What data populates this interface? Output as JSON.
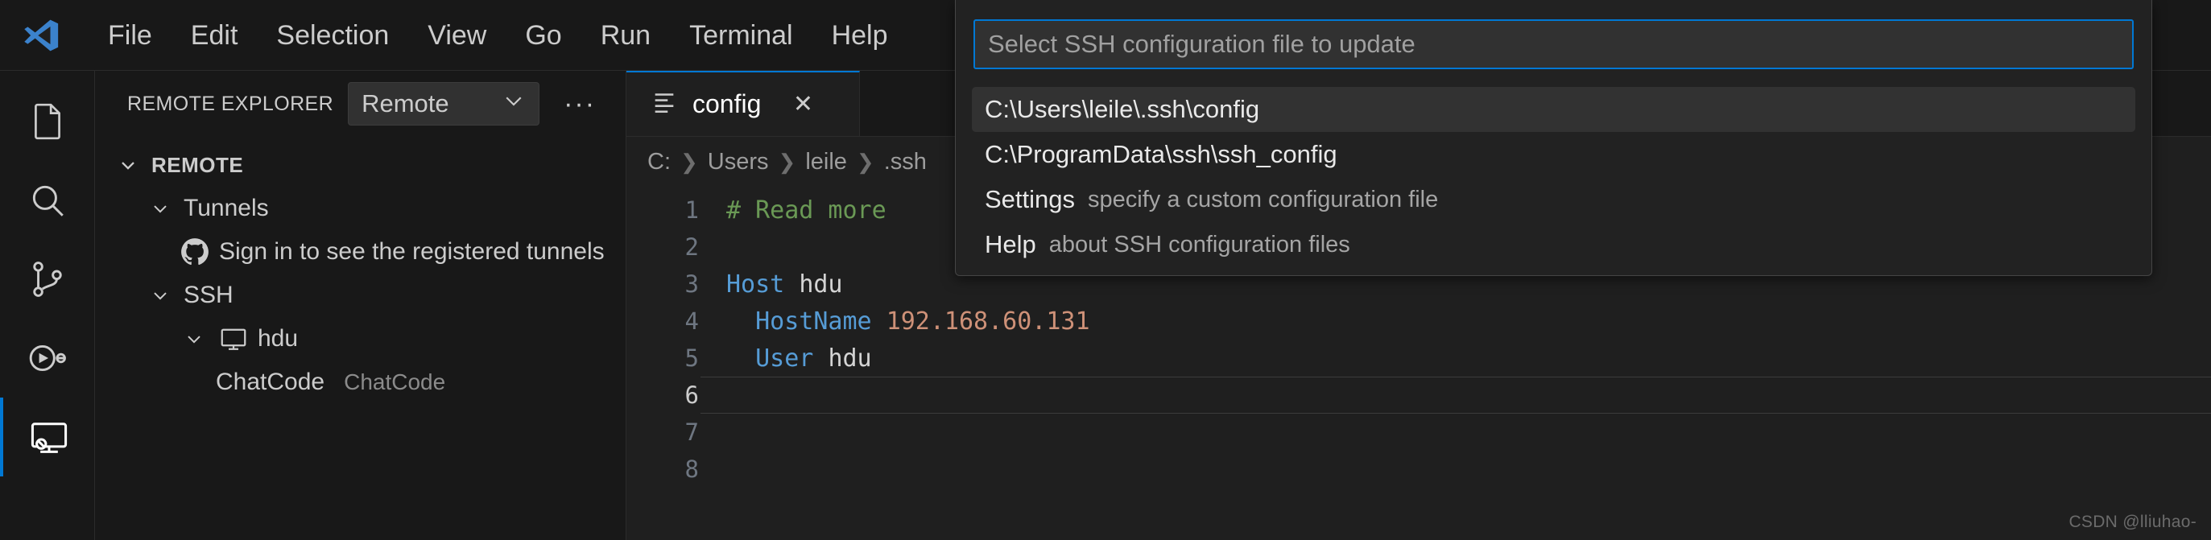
{
  "app": {
    "logo_icon": "vscode-logo-icon",
    "menu": [
      {
        "label": "File"
      },
      {
        "label": "Edit"
      },
      {
        "label": "Selection"
      },
      {
        "label": "View"
      },
      {
        "label": "Go"
      },
      {
        "label": "Run"
      },
      {
        "label": "Terminal"
      },
      {
        "label": "Help"
      }
    ]
  },
  "activity_bar": {
    "items": [
      {
        "name": "explorer-icon",
        "active": false
      },
      {
        "name": "search-icon",
        "active": false
      },
      {
        "name": "source-control-icon",
        "active": false
      },
      {
        "name": "run-and-debug-icon",
        "active": false
      },
      {
        "name": "remote-explorer-icon",
        "active": true
      }
    ]
  },
  "sidebar": {
    "title": "REMOTE EXPLORER",
    "dropdown": {
      "value": "Remote",
      "chevron_icon": "chevron-down-icon"
    },
    "more_actions": "···",
    "tree": [
      {
        "label": "REMOTE",
        "icon": "chevron-down-icon",
        "depth": 1,
        "bold": true,
        "description": ""
      },
      {
        "label": "Tunnels",
        "icon": "chevron-down-icon",
        "depth": 2,
        "bold": false,
        "description": ""
      },
      {
        "label": "Sign in to see the registered tunnels",
        "icon": "github-icon",
        "depth": 3,
        "bold": false,
        "description": ""
      },
      {
        "label": "SSH",
        "icon": "chevron-down-icon",
        "depth": 2,
        "bold": false,
        "description": ""
      },
      {
        "label": "hdu",
        "icon": "remote-machine-icon",
        "depth": 3,
        "bold": false,
        "description": ""
      },
      {
        "label": "ChatCode",
        "icon": "none",
        "depth": 4,
        "bold": false,
        "description": "ChatCode"
      }
    ]
  },
  "editor": {
    "tab": {
      "label": "config",
      "file_icon": "settings-file-icon",
      "close_icon": "close-icon"
    },
    "breadcrumb": [
      "C:",
      "Users",
      "leile",
      ".ssh"
    ],
    "lines": [
      {
        "n": "1",
        "tokens": [
          {
            "t": "# Read more",
            "c": "tok-comment"
          }
        ]
      },
      {
        "n": "2",
        "tokens": []
      },
      {
        "n": "3",
        "tokens": [
          {
            "t": "Host",
            "c": "tok-key"
          },
          {
            "t": " ",
            "c": "tok-plain"
          },
          {
            "t": "hdu",
            "c": "tok-plain"
          }
        ]
      },
      {
        "n": "4",
        "tokens": [
          {
            "t": "  ",
            "c": "tok-plain"
          },
          {
            "t": "HostName",
            "c": "tok-key"
          },
          {
            "t": " ",
            "c": "tok-plain"
          },
          {
            "t": "192.168.60.131",
            "c": "tok-str"
          }
        ]
      },
      {
        "n": "5",
        "tokens": [
          {
            "t": "  ",
            "c": "tok-plain"
          },
          {
            "t": "User",
            "c": "tok-key"
          },
          {
            "t": " ",
            "c": "tok-plain"
          },
          {
            "t": "hdu",
            "c": "tok-plain"
          }
        ]
      },
      {
        "n": "6",
        "tokens": []
      },
      {
        "n": "7",
        "tokens": []
      },
      {
        "n": "8",
        "tokens": []
      }
    ],
    "cursor_line": "6"
  },
  "quick_pick": {
    "placeholder": "Select SSH configuration file to update",
    "value": "",
    "items": [
      {
        "label": "C:\\Users\\leile\\.ssh\\config",
        "detail": "",
        "selected": true
      },
      {
        "label": "C:\\ProgramData\\ssh\\ssh_config",
        "detail": "",
        "selected": false
      },
      {
        "label": "Settings",
        "detail": "specify a custom configuration file",
        "selected": false
      },
      {
        "label": "Help",
        "detail": "about SSH configuration files",
        "selected": false
      }
    ]
  },
  "watermark": {
    "text": "CSDN @lliuhao-"
  },
  "colors": {
    "accent": "#0078d4",
    "bg": "#1f1f1f",
    "panel_bg": "#181818",
    "quickpick_bg": "#222222",
    "selected_row": "#323232",
    "comment": "#6a9955",
    "keyword": "#569cd6",
    "string": "#ce9178"
  }
}
